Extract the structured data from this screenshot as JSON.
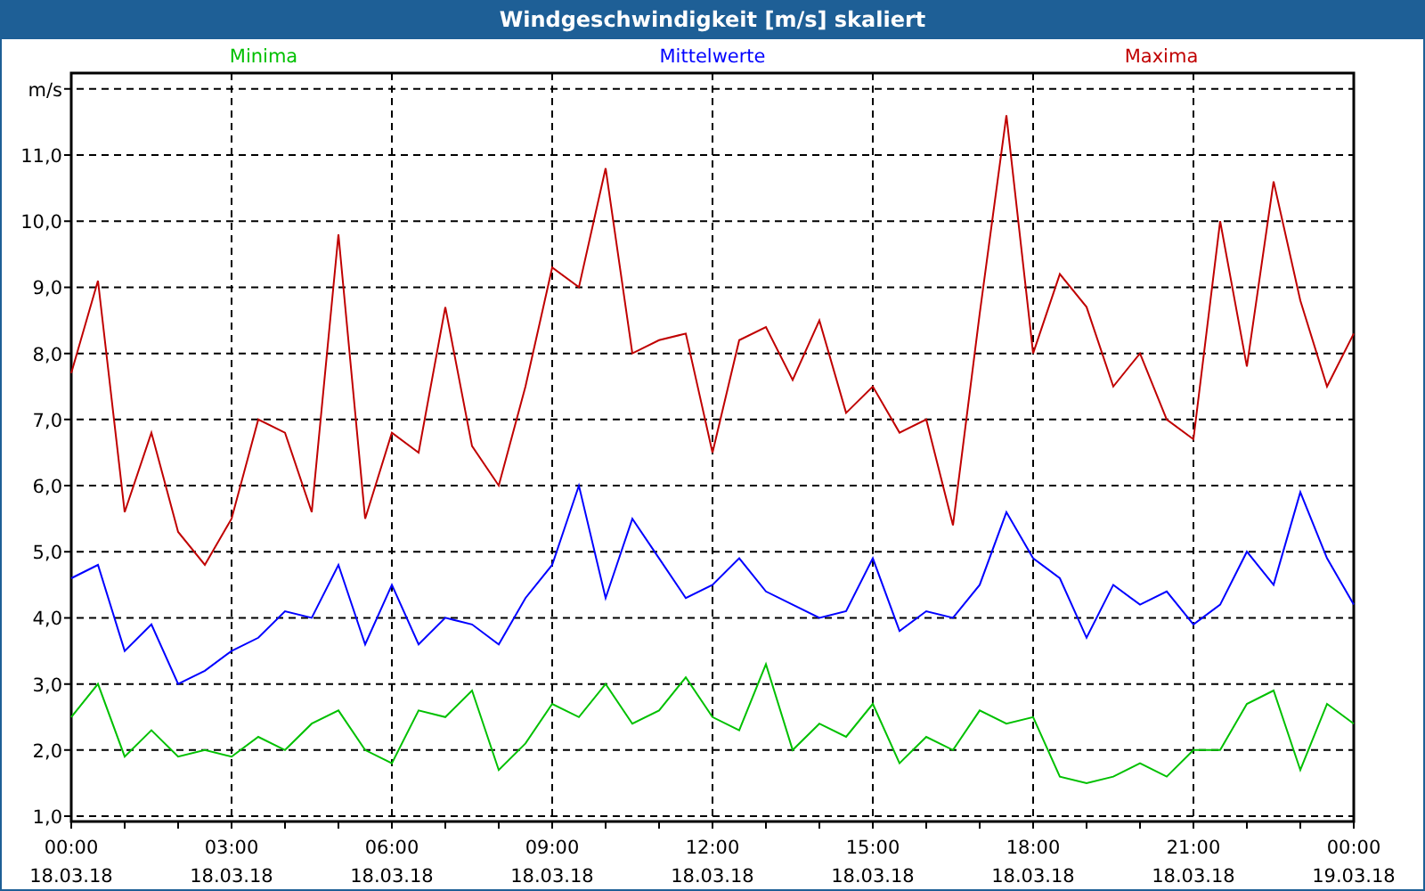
{
  "window": {
    "title": "Windgeschwindigkeit [m/s] skaliert"
  },
  "chart": {
    "chart_data": {
      "type": "line",
      "grid": true,
      "xlim": [
        0,
        24
      ],
      "ylim": [
        0.92,
        12.24
      ],
      "xticks": [
        {
          "value": 0,
          "label": "00:00"
        },
        {
          "value": 3,
          "label": "03:00"
        },
        {
          "value": 6,
          "label": "06:00"
        },
        {
          "value": 9,
          "label": "09:00"
        },
        {
          "value": 12,
          "label": "12:00"
        },
        {
          "value": 15,
          "label": "15:00"
        },
        {
          "value": 18,
          "label": "18:00"
        },
        {
          "value": 21,
          "label": "21:00"
        },
        {
          "value": 24,
          "label": "00:00"
        }
      ],
      "yticks": [
        {
          "value": 1,
          "label": "1,0"
        },
        {
          "value": 2,
          "label": "2,0"
        },
        {
          "value": 3,
          "label": "3,0"
        },
        {
          "value": 4,
          "label": "4,0"
        },
        {
          "value": 5,
          "label": "5,0"
        },
        {
          "value": 6,
          "label": "6,0"
        },
        {
          "value": 7,
          "label": "7,0"
        },
        {
          "value": 8,
          "label": "8,0"
        },
        {
          "value": 9,
          "label": "9,0"
        },
        {
          "value": 10,
          "label": "10,0"
        },
        {
          "value": 11,
          "label": "11,0"
        },
        {
          "value": 12,
          "label": "m/s"
        }
      ],
      "x": [
        0,
        0.5,
        1,
        1.5,
        2,
        2.5,
        3,
        3.5,
        4,
        4.5,
        5,
        5.5,
        6,
        6.5,
        7,
        7.5,
        8,
        8.5,
        9,
        9.5,
        10,
        10.5,
        11,
        11.5,
        12,
        12.5,
        13,
        13.5,
        14,
        14.5,
        15,
        15.5,
        16,
        16.5,
        17,
        17.5,
        18,
        18.5,
        19,
        19.5,
        20,
        20.5,
        21,
        21.5,
        22,
        22.5,
        23,
        23.5,
        24
      ],
      "series": [
        {
          "name": "Minima",
          "color": "#00c000",
          "values": [
            2.5,
            3.0,
            1.9,
            2.3,
            1.9,
            2.0,
            1.9,
            2.2,
            2.0,
            2.4,
            2.6,
            2.0,
            1.8,
            2.6,
            2.5,
            2.9,
            1.7,
            2.1,
            2.7,
            2.5,
            3.0,
            2.4,
            2.6,
            3.1,
            2.5,
            2.3,
            3.3,
            2.0,
            2.4,
            2.2,
            2.7,
            1.8,
            2.2,
            2.0,
            2.6,
            2.4,
            2.5,
            1.6,
            1.5,
            1.6,
            1.8,
            1.6,
            2.0,
            2.0,
            2.7,
            2.9,
            1.7,
            2.7,
            2.4
          ]
        },
        {
          "name": "Mittelwerte",
          "color": "#0000ff",
          "values": [
            4.6,
            4.8,
            3.5,
            3.9,
            3.0,
            3.2,
            3.5,
            3.7,
            4.1,
            4.0,
            4.8,
            3.6,
            4.5,
            3.6,
            4.0,
            3.9,
            3.6,
            4.3,
            4.8,
            6.0,
            4.3,
            5.5,
            4.9,
            4.3,
            4.5,
            4.9,
            4.4,
            4.2,
            4.0,
            4.1,
            4.9,
            3.8,
            4.1,
            4.0,
            4.5,
            5.6,
            4.9,
            4.6,
            3.7,
            4.5,
            4.2,
            4.4,
            3.9,
            4.2,
            5.0,
            4.5,
            5.9,
            4.9,
            4.2
          ]
        },
        {
          "name": "Maxima",
          "color": "#c00000",
          "values": [
            7.7,
            9.1,
            5.6,
            6.8,
            5.3,
            4.8,
            5.5,
            7.0,
            6.8,
            5.6,
            9.8,
            5.5,
            6.8,
            6.5,
            8.7,
            6.6,
            6.0,
            7.5,
            9.3,
            9.0,
            10.8,
            8.0,
            8.2,
            8.3,
            6.5,
            8.2,
            8.4,
            7.6,
            8.5,
            7.1,
            7.5,
            6.8,
            7.0,
            5.4,
            8.6,
            11.6,
            8.0,
            9.2,
            8.7,
            7.5,
            8.0,
            7.0,
            6.7,
            10.0,
            7.8,
            10.6,
            8.8,
            7.5,
            8.3
          ]
        }
      ]
    },
    "xtick_dates": [
      "18.03.18",
      "18.03.18",
      "18.03.18",
      "18.03.18",
      "18.03.18",
      "18.03.18",
      "18.03.18",
      "18.03.18",
      "19.03.18"
    ]
  }
}
